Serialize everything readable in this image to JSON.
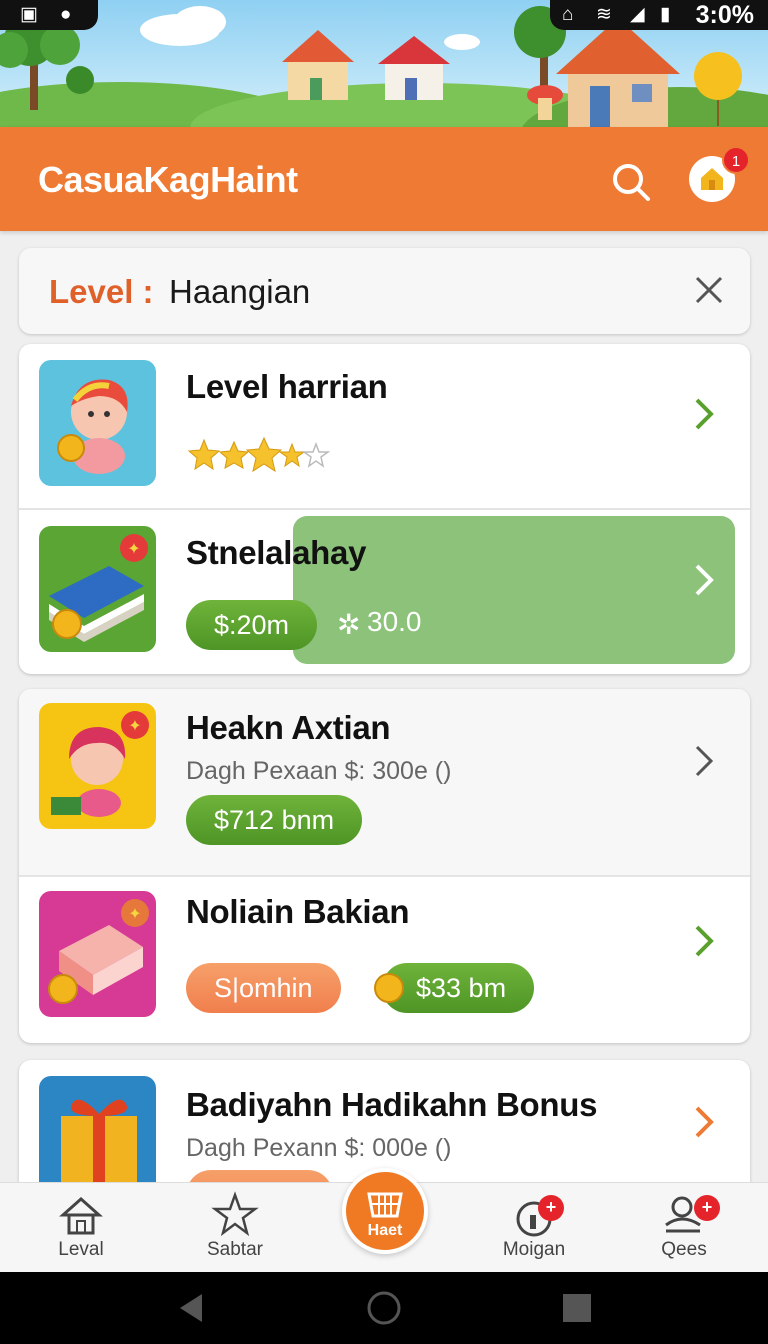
{
  "status_bar": {
    "time": "3:0%"
  },
  "header": {
    "title": "CasuaKagHaint",
    "notification_count": "1"
  },
  "level_filter": {
    "label": "Level :",
    "value": "Haangian"
  },
  "items": [
    {
      "title": "Level harrian",
      "rating_stars": 4
    },
    {
      "title": "Stnelalahay",
      "price": "$:20m",
      "rating": "30.0"
    },
    {
      "title": "Heakn Axtian",
      "subtitle": "Dagh Pexaan  $: 300e ()",
      "price": "$712 bnm"
    },
    {
      "title": "Noliain Bakian",
      "tag": "S|omhin",
      "price": "$33 bm"
    },
    {
      "title": "Badiyahn Hadikahn Bonus",
      "subtitle": "Dagh Pexann  $: 000e ()"
    }
  ],
  "bottom_nav": {
    "items": [
      {
        "label": "Leval",
        "icon": "home-icon"
      },
      {
        "label": "Sabtar",
        "icon": "star-icon"
      },
      {
        "label": "Haet",
        "icon": "basket-icon"
      },
      {
        "label": "Moigan",
        "icon": "clock-icon",
        "badge": "+"
      },
      {
        "label": "Qees",
        "icon": "people-icon",
        "badge": "+"
      }
    ]
  },
  "colors": {
    "accent": "#ee7a33",
    "green": "#5aa02c",
    "orange_pill": "#f28a57",
    "badge": "#e5232a"
  }
}
